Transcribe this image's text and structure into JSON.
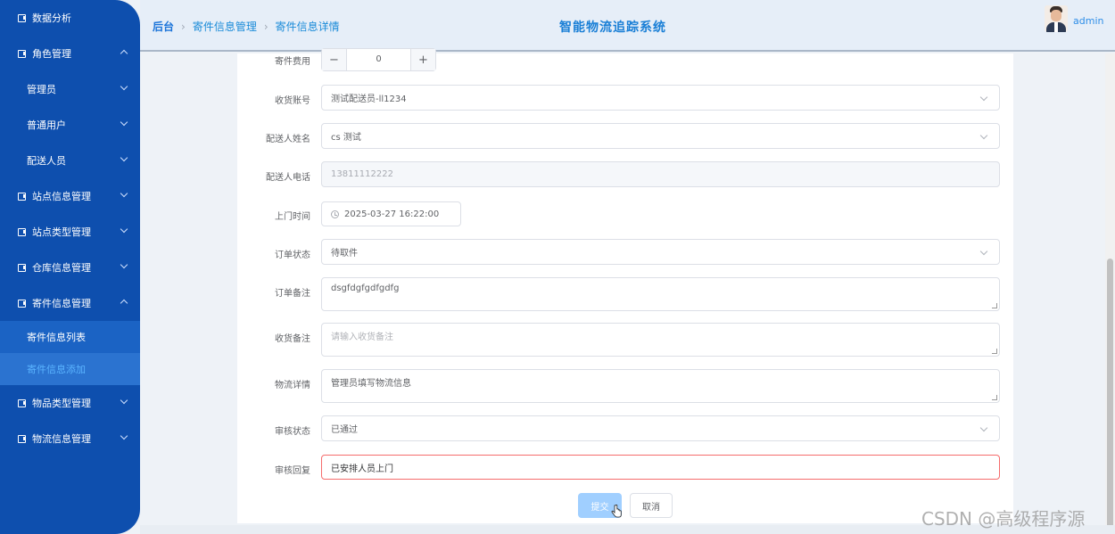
{
  "sidebar": {
    "items": [
      {
        "label": "数据分析"
      },
      {
        "label": "角色管理"
      },
      {
        "label": "管理员"
      },
      {
        "label": "普通用户"
      },
      {
        "label": "配送人员"
      },
      {
        "label": "站点信息管理"
      },
      {
        "label": "站点类型管理"
      },
      {
        "label": "仓库信息管理"
      },
      {
        "label": "寄件信息管理"
      },
      {
        "label": "寄件信息列表"
      },
      {
        "label": "寄件信息添加"
      },
      {
        "label": "物品类型管理"
      },
      {
        "label": "物流信息管理"
      }
    ]
  },
  "header": {
    "breadcrumb": [
      "后台",
      "寄件信息管理",
      "寄件信息详情"
    ],
    "title": "智能物流追踪系统",
    "user": "admin"
  },
  "form": {
    "fee": {
      "label": "寄件费用",
      "value": "0",
      "minus": "−",
      "plus": "+"
    },
    "receiver_account": {
      "label": "收货账号",
      "value": "测试配送员-ll1234"
    },
    "courier_name": {
      "label": "配送人姓名",
      "value": "cs 测试"
    },
    "courier_phone": {
      "label": "配送人电话",
      "value": "13811112222"
    },
    "pickup_time": {
      "label": "上门时间",
      "value": "2025-03-27 16:22:00"
    },
    "order_status": {
      "label": "订单状态",
      "value": "待取件"
    },
    "order_note": {
      "label": "订单备注",
      "value": "dsgfdgfgdfgdfg"
    },
    "receive_note": {
      "label": "收货备注",
      "placeholder": "请输入收货备注"
    },
    "logistics_detail": {
      "label": "物流详情",
      "value": "管理员填写物流信息"
    },
    "audit_status": {
      "label": "审核状态",
      "value": "已通过"
    },
    "audit_reply": {
      "label": "审核回复",
      "value": "已安排人员上门"
    },
    "submit_label": "提交",
    "cancel_label": "取消"
  },
  "watermark": "CSDN @高级程序源",
  "colors": {
    "sidebar": "#0e4fae",
    "accent": "#1a7fd6",
    "submit": "#a0cfff",
    "error": "#f56c6c"
  }
}
